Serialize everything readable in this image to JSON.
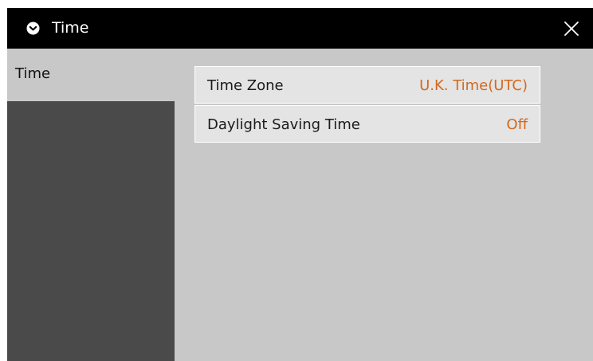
{
  "window": {
    "title": "Time",
    "title_icon": "clock-icon",
    "close_icon": "close-icon"
  },
  "sidebar": {
    "items": [
      {
        "label": "Time",
        "selected": true
      }
    ]
  },
  "settings": [
    {
      "label": "Time Zone",
      "value": "U.K. Time(UTC)"
    },
    {
      "label": "Daylight Saving Time",
      "value": "Off"
    }
  ],
  "colors": {
    "titlebar_bg": "#000000",
    "panel_bg": "#c8c8c8",
    "sidebar_bg": "#4a4a4a",
    "row_bg": "#e4e4e4",
    "value_accent": "#d2691e"
  }
}
